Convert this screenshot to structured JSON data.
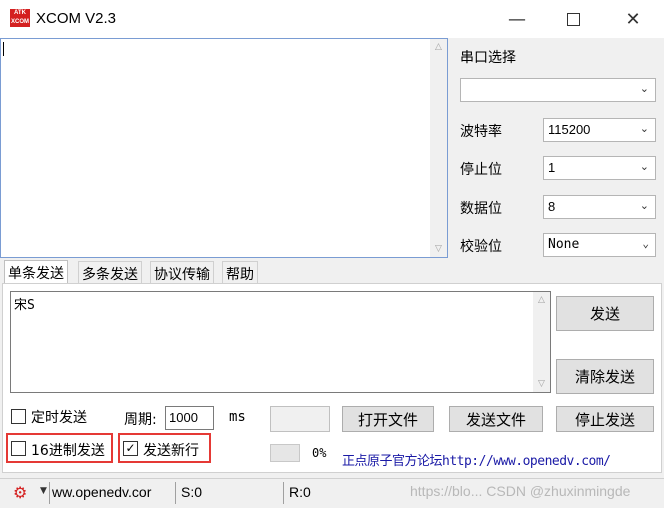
{
  "window": {
    "title": "XCOM V2.3",
    "logo_text": "ATK XCOM",
    "min_icon": "minimize-icon",
    "max_icon": "maximize-icon",
    "close_icon": "close-icon"
  },
  "receive": {
    "text": ""
  },
  "serial": {
    "port_label": "串口选择",
    "port_value": "",
    "baud_label": "波特率",
    "baud_value": "115200",
    "stop_label": "停止位",
    "stop_value": "1",
    "data_label": "数据位",
    "data_value": "8",
    "parity_label": "校验位",
    "parity_value": "None"
  },
  "tabs": [
    "单条发送",
    "多条发送",
    "协议传输",
    "帮助"
  ],
  "send": {
    "text": "宋S",
    "send_button": "发送",
    "clear_button": "清除发送"
  },
  "options": {
    "timed_send": "定时发送",
    "period_label": "周期:",
    "period_value": "1000",
    "period_unit": "ms",
    "hex_send": "16进制发送",
    "newline_send": "发送新行",
    "newline_checked": true,
    "open_file": "打开文件",
    "send_file": "发送文件",
    "stop_send": "停止发送",
    "progress": "0%",
    "forum_text": "正点原子官方论坛http://www.openedv.com/"
  },
  "status": {
    "gear_icon": "gear-icon",
    "site": "ww.openedv.cor",
    "sent": "S:0",
    "received": "R:0",
    "watermark": "https://blo... CSDN @zhuxinmingde"
  },
  "colors": {
    "highlight_red": "#e53935",
    "link_blue": "#1a1aa6",
    "logo_red": "#d42020"
  }
}
